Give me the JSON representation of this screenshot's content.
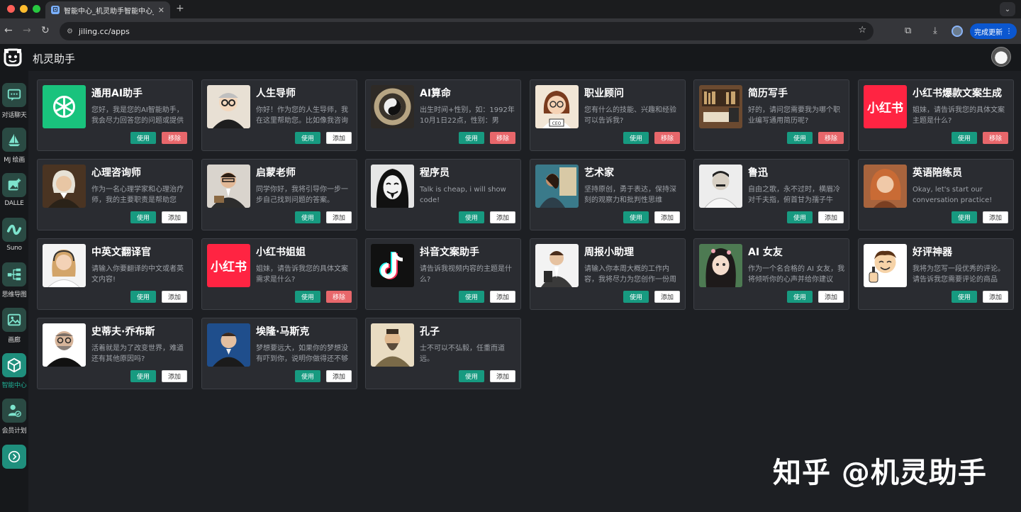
{
  "browser": {
    "tab_title": "智能中心_机灵助手智能中心_人",
    "tab_close": "✕",
    "new_tab": "+",
    "url": "jiling.cc/apps",
    "update_label": "完成更新"
  },
  "app": {
    "title": "机灵助手"
  },
  "sidebar": {
    "items": [
      {
        "label": "对话聊天",
        "icon": "chat-icon"
      },
      {
        "label": "MJ 绘画",
        "icon": "sailboat-icon"
      },
      {
        "label": "DALLE",
        "icon": "image-plus-icon"
      },
      {
        "label": "Suno",
        "icon": "wave-icon"
      },
      {
        "label": "思维导图",
        "icon": "mindmap-icon"
      },
      {
        "label": "画廊",
        "icon": "gallery-icon"
      },
      {
        "label": "智能中心",
        "icon": "cube-icon"
      },
      {
        "label": "会员计划",
        "icon": "member-icon"
      }
    ],
    "expand_icon": "chevron-right-icon"
  },
  "buttons": {
    "use": "使用",
    "add": "添加",
    "remove": "移除"
  },
  "cards": [
    {
      "title": "通用AI助手",
      "desc": "您好，我是您的AI智能助手，我会尽力回答您的问题或提供有用的建议",
      "action": "remove",
      "thumb": "chatgpt-logo"
    },
    {
      "title": "人生导师",
      "desc": "你好！作为您的人生导师，我在这里帮助您。比如像我咨询关于人生规划的问题",
      "action": "add",
      "thumb": "mentor-portrait"
    },
    {
      "title": "AI算命",
      "desc": "出生时间+性别，如：1992年10月1日22点，性别：男",
      "action": "remove",
      "thumb": "yinyang-compass"
    },
    {
      "title": "职业顾问",
      "desc": "您有什么的技能、兴趣和经验可以告诉我?",
      "action": "remove",
      "thumb": "ceo-cartoon"
    },
    {
      "title": "简历写手",
      "desc": "好的，请问您需要我为哪个职业编写通用简历呢?",
      "action": "remove",
      "thumb": "study-desk"
    },
    {
      "title": "小红书爆款文案生成",
      "desc": "姐妹，请告诉我您的具体文案主题是什么?",
      "action": "remove",
      "thumb": "xiaohongshu-logo"
    },
    {
      "title": "心理咨询师",
      "desc": "作为一名心理学家和心理治疗师，我的主要职责是帮助您",
      "action": "add",
      "thumb": "philosopher-portrait"
    },
    {
      "title": "启蒙老师",
      "desc": "同学你好，我将引导你一步一步自己找到问题的答案。",
      "action": "add",
      "thumb": "teacher-portrait"
    },
    {
      "title": "程序员",
      "desc": "Talk is cheap, i will show code!",
      "action": "add",
      "thumb": "hacker-mask"
    },
    {
      "title": "艺术家",
      "desc": "坚持原创，勇于表达，保持深刻的观察力和批判性思维",
      "action": "add",
      "thumb": "artist-painting"
    },
    {
      "title": "鲁迅",
      "desc": "自由之歌，永不过时，横眉冷对千夫指，俯首甘为孺子牛",
      "action": "add",
      "thumb": "luxun-portrait"
    },
    {
      "title": "英语陪练员",
      "desc": "Okay, let's start our conversation practice! What's your name?",
      "action": "add",
      "thumb": "woman-portrait"
    },
    {
      "title": "中英文翻译官",
      "desc": "请输入你要翻译的中文或者英文内容!",
      "action": "add",
      "thumb": "operator-portrait"
    },
    {
      "title": "小红书姐姐",
      "desc": "姐妹，请告诉我您的具体文案需求是什么?",
      "action": "remove",
      "thumb": "xiaohongshu-logo"
    },
    {
      "title": "抖音文案助手",
      "desc": "请告诉我视频内容的主题是什么?",
      "action": "add",
      "thumb": "douyin-logo"
    },
    {
      "title": "周报小助理",
      "desc": "请输入你本周大概的工作内容，我将尽力为您创作一份周报",
      "action": "add",
      "thumb": "office-worker"
    },
    {
      "title": "AI 女友",
      "desc": "作为一个名合格的 AI 女友，我将倾听你的心声并给你建议",
      "action": "add",
      "thumb": "anime-girl"
    },
    {
      "title": "好评神器",
      "desc": "我将为您写一段优秀的评论。请告诉我您需要评论的商品",
      "action": "add",
      "thumb": "thumbs-up-cartoon"
    },
    {
      "title": "史蒂夫·乔布斯",
      "desc": "活着就是为了改变世界，难道还有其他原因吗?",
      "action": "add",
      "thumb": "jobs-portrait"
    },
    {
      "title": "埃隆·马斯克",
      "desc": "梦想要远大，如果你的梦想没有吓到你，说明你做得还不够",
      "action": "add",
      "thumb": "musk-portrait"
    },
    {
      "title": "孔子",
      "desc": "士不可以不弘毅，任重而道远。",
      "action": "add",
      "thumb": "confucius-portrait"
    }
  ],
  "watermark": "知乎 @机灵助手"
}
